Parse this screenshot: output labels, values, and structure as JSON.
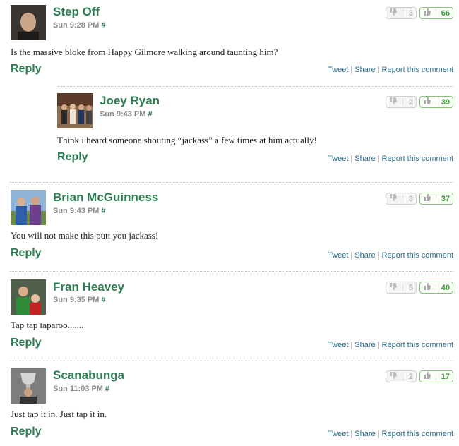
{
  "comments": [
    {
      "author": "Step Off",
      "time": "Sun 9:28 PM",
      "hash": "#",
      "body": "Is the massive bloke from Happy Gilmore walking around taunting him?",
      "reply": "Reply",
      "down": "3",
      "up": "66",
      "tweet": "Tweet",
      "share": "Share",
      "report": "Report this comment"
    },
    {
      "author": "Joey Ryan",
      "time": "Sun 9:43 PM",
      "hash": "#",
      "body": "Think i heard someone shouting “jackass” a few times at him actually!",
      "reply": "Reply",
      "down": "2",
      "up": "39",
      "tweet": "Tweet",
      "share": "Share",
      "report": "Report this comment"
    },
    {
      "author": "Brian McGuinness",
      "time": "Sun 9:43 PM",
      "hash": "#",
      "body": "You will not make this putt you jackass!",
      "reply": "Reply",
      "down": "3",
      "up": "37",
      "tweet": "Tweet",
      "share": "Share",
      "report": "Report this comment"
    },
    {
      "author": "Fran Heavey",
      "time": "Sun 9:35 PM",
      "hash": "#",
      "body": "Tap tap taparoo.......",
      "reply": "Reply",
      "down": "5",
      "up": "40",
      "tweet": "Tweet",
      "share": "Share",
      "report": "Report this comment"
    },
    {
      "author": "Scanabunga",
      "time": "Sun 11:03 PM",
      "hash": "#",
      "body": "Just tap it in. Just tap it in.",
      "reply": "Reply",
      "down": "2",
      "up": "17",
      "tweet": "Tweet",
      "share": "Share",
      "report": "Report this comment"
    }
  ],
  "icons": {
    "down": "thumbs-down-icon",
    "up": "thumbs-up-icon"
  },
  "colors": {
    "accent": "#2e7d54",
    "link": "#2b6a8a",
    "up": "#3f9a3a"
  }
}
